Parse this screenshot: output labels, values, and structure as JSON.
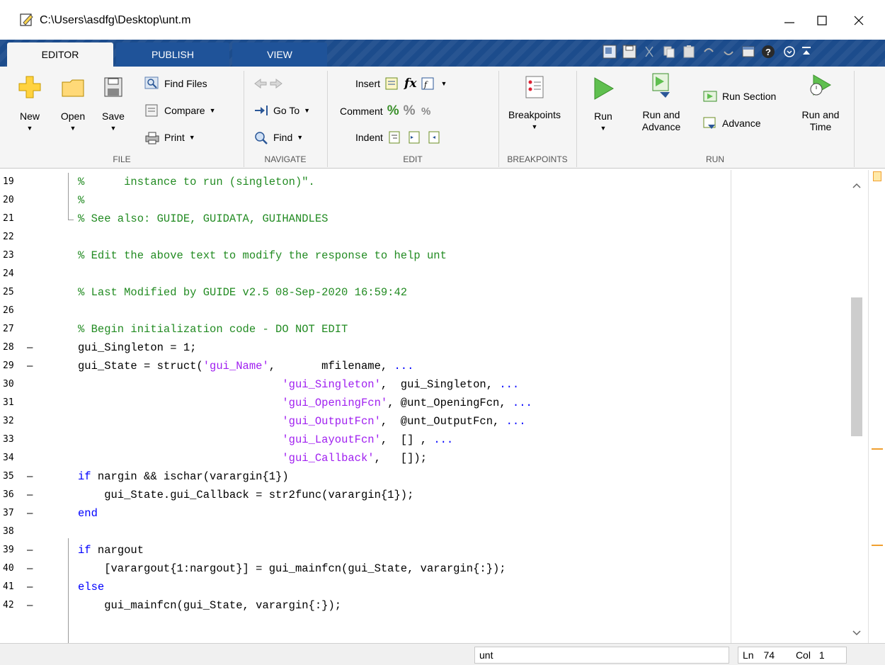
{
  "window": {
    "title": "C:\\Users\\asdfg\\Desktop\\unt.m",
    "minimize_glyph": "—",
    "maximize_glyph": "☐",
    "close_glyph": "✕"
  },
  "tabs": [
    {
      "label": "EDITOR",
      "active": true
    },
    {
      "label": "PUBLISH",
      "active": false
    },
    {
      "label": "VIEW",
      "active": false
    }
  ],
  "quick_access_icons": [
    "favorite-icon",
    "save-icon",
    "cut-icon",
    "copy-icon",
    "paste-icon",
    "undo-icon",
    "redo-icon",
    "window-icon",
    "help-icon",
    "expand-icon",
    "collapse-ribbon-icon"
  ],
  "ribbon": {
    "file": {
      "section_label": "FILE",
      "new_label": "New",
      "open_label": "Open",
      "save_label": "Save",
      "find_files_label": "Find Files",
      "compare_label": "Compare",
      "print_label": "Print"
    },
    "navigate": {
      "section_label": "NAVIGATE",
      "goto_label": "Go To",
      "find_label": "Find"
    },
    "edit": {
      "section_label": "EDIT",
      "insert_label": "Insert",
      "comment_label": "Comment",
      "indent_label": "Indent",
      "fx_glyph": "fx"
    },
    "breakpoints": {
      "section_label": "BREAKPOINTS",
      "breakpoints_label": "Breakpoints"
    },
    "run": {
      "section_label": "RUN",
      "run_label": "Run",
      "run_and_advance_label_1": "Run and",
      "run_and_advance_label_2": "Advance",
      "run_section_label": "Run Section",
      "advance_label": "Advance",
      "run_and_time_label_1": "Run and",
      "run_and_time_label_2": "Time"
    }
  },
  "editor": {
    "lines": [
      {
        "num": "19",
        "dash": "",
        "text": "%      instance to run (singleton)\".",
        "kind": "cm"
      },
      {
        "num": "20",
        "dash": "",
        "text": "%",
        "kind": "cm"
      },
      {
        "num": "21",
        "dash": "",
        "text": "% See also: GUIDE, GUIDATA, GUIHANDLES",
        "kind": "cm"
      },
      {
        "num": "22",
        "dash": "",
        "text": "",
        "kind": "plain"
      },
      {
        "num": "23",
        "dash": "",
        "text": "% Edit the above text to modify the response to help unt",
        "kind": "cm"
      },
      {
        "num": "24",
        "dash": "",
        "text": "",
        "kind": "plain"
      },
      {
        "num": "25",
        "dash": "",
        "text": "% Last Modified by GUIDE v2.5 08-Sep-2020 16:59:42",
        "kind": "cm"
      },
      {
        "num": "26",
        "dash": "",
        "text": "",
        "kind": "plain"
      },
      {
        "num": "27",
        "dash": "",
        "text": "% Begin initialization code - DO NOT EDIT",
        "kind": "cm"
      },
      {
        "num": "28",
        "dash": "—",
        "text": "gui_Singleton = 1;",
        "kind": "plain"
      },
      {
        "num": "29",
        "dash": "—",
        "text": "",
        "kind": "mixed"
      },
      {
        "num": "30",
        "dash": "",
        "text": "",
        "kind": "mixed"
      },
      {
        "num": "31",
        "dash": "",
        "text": "",
        "kind": "mixed"
      },
      {
        "num": "32",
        "dash": "",
        "text": "",
        "kind": "mixed"
      },
      {
        "num": "33",
        "dash": "",
        "text": "",
        "kind": "mixed"
      },
      {
        "num": "34",
        "dash": "",
        "text": "",
        "kind": "mixed"
      },
      {
        "num": "35",
        "dash": "—",
        "text": "",
        "kind": "mixed"
      },
      {
        "num": "36",
        "dash": "—",
        "text": "    gui_State.gui_Callback = str2func(varargin{1});",
        "kind": "plain"
      },
      {
        "num": "37",
        "dash": "—",
        "text": "end",
        "kind": "kw"
      },
      {
        "num": "38",
        "dash": "",
        "text": "",
        "kind": "plain"
      },
      {
        "num": "39",
        "dash": "—",
        "text": "",
        "kind": "mixed"
      },
      {
        "num": "40",
        "dash": "—",
        "text": "    [varargout{1:nargout}] = gui_mainfcn(gui_State, varargin{:});",
        "kind": "plain"
      },
      {
        "num": "41",
        "dash": "—",
        "text": "else",
        "kind": "kw"
      },
      {
        "num": "42",
        "dash": "—",
        "text": "    gui_mainfcn(gui_State, varargin{:});",
        "kind": "plain"
      }
    ],
    "mixed": {
      "l29_a": "gui_State = struct(",
      "l29_s": "'gui_Name'",
      "l29_b": ",       mfilename, ",
      "l30_s": "'gui_Singleton'",
      "l30_b": ",  gui_Singleton, ",
      "l31_s": "'gui_OpeningFcn'",
      "l31_b": ", @unt_OpeningFcn, ",
      "l32_s": "'gui_OutputFcn'",
      "l32_b": ",  @unt_OutputFcn, ",
      "l33_s": "'gui_LayoutFcn'",
      "l33_b": ",  [] , ",
      "l34_s": "'gui_Callback'",
      "l34_b": ",   []);",
      "l35_kw": "if",
      "l35_b": " nargin && ischar(varargin{1})",
      "l39_kw": "if",
      "l39_b": " nargout",
      "continuation": "..."
    }
  },
  "statusbar": {
    "filename": "unt",
    "ln_label": "Ln",
    "ln_value": "74",
    "col_label": "Col",
    "col_value": "1"
  },
  "colors": {
    "comment": "#228b22",
    "keyword": "#0000ff",
    "string": "#a020f0",
    "tabstrip": "#1c4c8c",
    "warning_marker": "#f0a030"
  }
}
